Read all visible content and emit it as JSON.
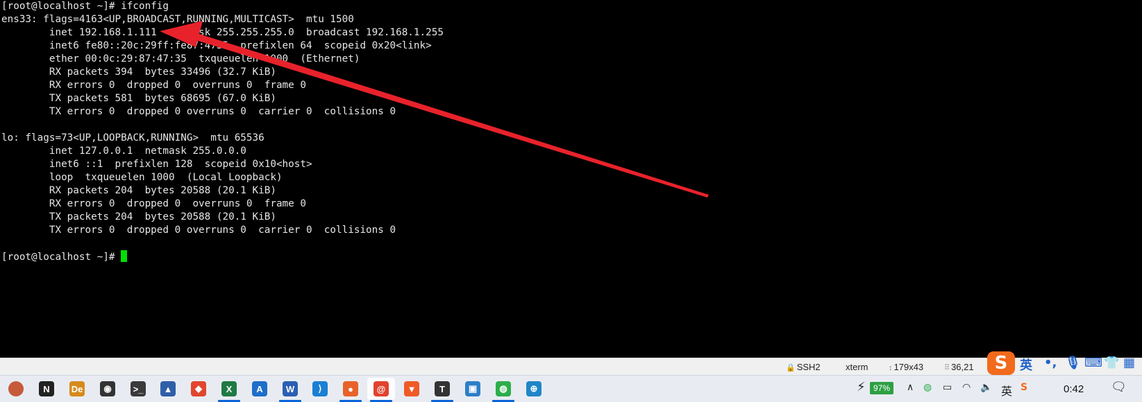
{
  "terminal": {
    "lines": [
      "[root@localhost ~]# ifconfig",
      "ens33: flags=4163<UP,BROADCAST,RUNNING,MULTICAST>  mtu 1500",
      "        inet 192.168.1.111  netmask 255.255.255.0  broadcast 192.168.1.255",
      "        inet6 fe80::20c:29ff:fe87:4735  prefixlen 64  scopeid 0x20<link>",
      "        ether 00:0c:29:87:47:35  txqueuelen 1000  (Ethernet)",
      "        RX packets 394  bytes 33496 (32.7 KiB)",
      "        RX errors 0  dropped 0  overruns 0  frame 0",
      "        TX packets 581  bytes 68695 (67.0 KiB)",
      "        TX errors 0  dropped 0 overruns 0  carrier 0  collisions 0",
      "",
      "lo: flags=73<UP,LOOPBACK,RUNNING>  mtu 65536",
      "        inet 127.0.0.1  netmask 255.0.0.0",
      "        inet6 ::1  prefixlen 128  scopeid 0x10<host>",
      "        loop  txqueuelen 1000  (Local Loopback)",
      "        RX packets 204  bytes 20588 (20.1 KiB)",
      "        RX errors 0  dropped 0  overruns 0  frame 0",
      "        TX packets 204  bytes 20588 (20.1 KiB)",
      "        TX errors 0  dropped 0 overruns 0  carrier 0  collisions 0",
      ""
    ],
    "prompt": "[root@localhost ~]# ",
    "text_color": "#e6e6e6",
    "cursor_color": "#00e000",
    "annotation_color": "#e8222b"
  },
  "statusbar": {
    "protocol": "SSH2",
    "terminal_type": "xterm",
    "size": "179x43",
    "cursor_pos": "36,21"
  },
  "ime": {
    "logo": "S",
    "lang": "英",
    "punct": "•,"
  },
  "taskbar": {
    "apps": [
      {
        "name": "avatar-app",
        "glyph": "",
        "color": "#c65a3a"
      },
      {
        "name": "notion-app",
        "glyph": "N",
        "color": "#222222"
      },
      {
        "name": "davinci-app",
        "glyph": "De",
        "color": "#d68a1c"
      },
      {
        "name": "obs-app",
        "glyph": "◉",
        "color": "#333333"
      },
      {
        "name": "terminal-app",
        "glyph": ">_",
        "color": "#3a3a3a"
      },
      {
        "name": "xshell-app",
        "glyph": "▲",
        "color": "#2f5fa8"
      },
      {
        "name": "git-app",
        "glyph": "◆",
        "color": "#e1452f"
      },
      {
        "name": "excel-app",
        "glyph": "X",
        "color": "#1e7b44"
      },
      {
        "name": "azure-app",
        "glyph": "A",
        "color": "#1f6ec9"
      },
      {
        "name": "word-app",
        "glyph": "W",
        "color": "#2b5fb3"
      },
      {
        "name": "vscode-app",
        "glyph": "⟩",
        "color": "#1b7fd4"
      },
      {
        "name": "firefox-app",
        "glyph": "●",
        "color": "#e8622a"
      },
      {
        "name": "xshell-active-app",
        "glyph": "@",
        "color": "#e0432f"
      },
      {
        "name": "brave-app",
        "glyph": "▼",
        "color": "#f05a28"
      },
      {
        "name": "typora-app",
        "glyph": "T",
        "color": "#333333"
      },
      {
        "name": "frame-app",
        "glyph": "▣",
        "color": "#2d7fc9"
      },
      {
        "name": "wechat-app",
        "glyph": "◍",
        "color": "#2dae4b"
      },
      {
        "name": "network-app",
        "glyph": "⊕",
        "color": "#1f86c9"
      }
    ],
    "tray": {
      "battery": "97%",
      "ime_lang": "英",
      "clock": "0:42"
    }
  }
}
